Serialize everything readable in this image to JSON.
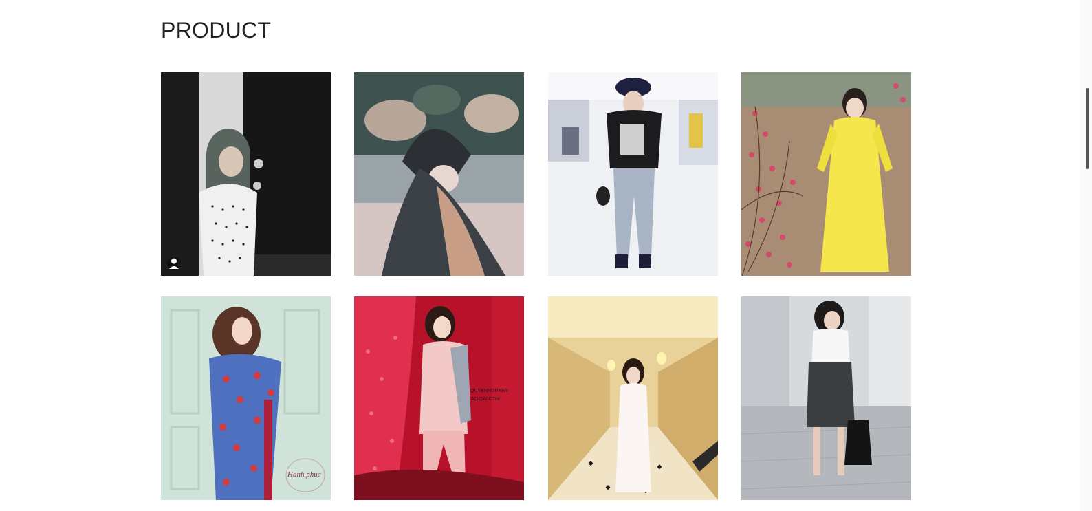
{
  "section": {
    "title": "PRODUCT"
  },
  "products": [
    {
      "name": "product-1",
      "alt": "girl-in-polka-dot-top"
    },
    {
      "name": "product-2",
      "alt": "girl-in-black-cap"
    },
    {
      "name": "product-3",
      "alt": "boy-in-bucket-hat"
    },
    {
      "name": "product-4",
      "alt": "woman-in-yellow-ao-dai"
    },
    {
      "name": "product-5",
      "alt": "woman-in-floral-blue-ao-dai"
    },
    {
      "name": "product-6",
      "alt": "woman-in-pink-lace-ao-dai"
    },
    {
      "name": "product-7",
      "alt": "woman-in-white-ao-dai"
    },
    {
      "name": "product-8",
      "alt": "woman-in-white-shirt-grey-skirt"
    }
  ],
  "photo_watermarks": {
    "product_6": [
      "QUYENNGUYEN",
      "AO DAI CTHI"
    ],
    "product_5": "Hanh phuc"
  }
}
